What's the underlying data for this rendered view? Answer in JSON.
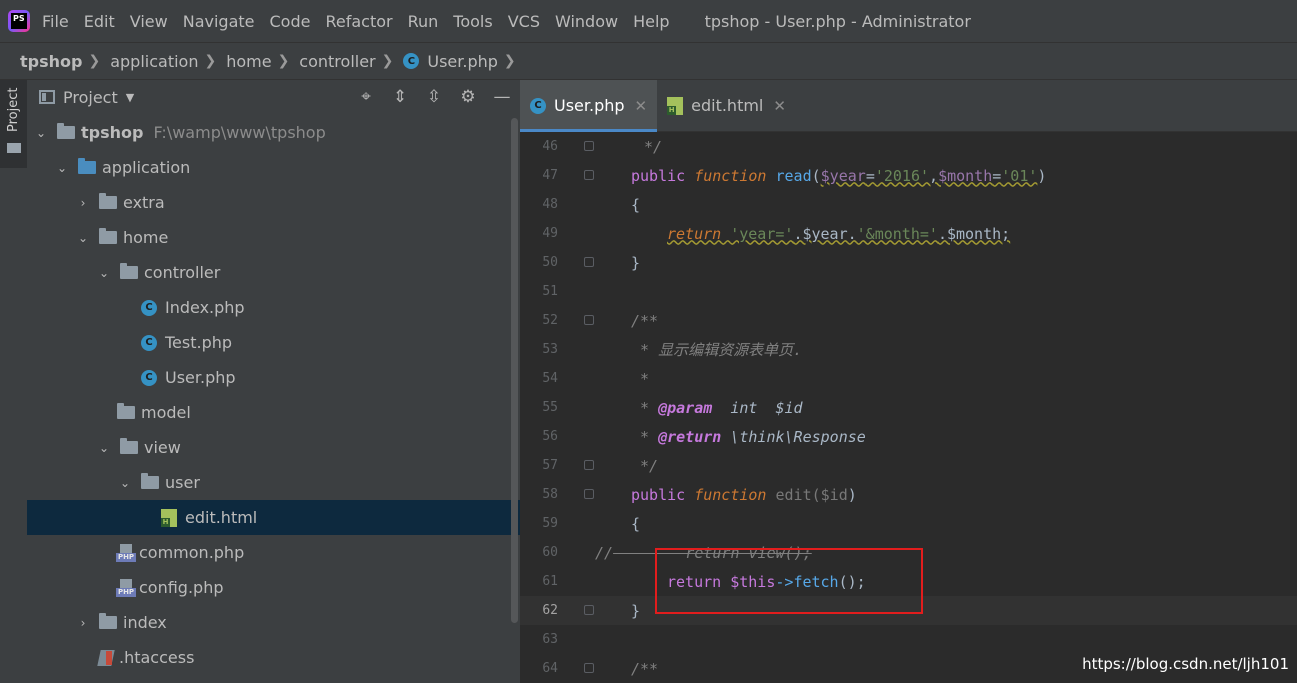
{
  "menubar": {
    "logo_text": "PS",
    "items": [
      "File",
      "Edit",
      "View",
      "Navigate",
      "Code",
      "Refactor",
      "Run",
      "Tools",
      "VCS",
      "Window",
      "Help"
    ],
    "window_title": "tpshop - User.php - Administrator"
  },
  "breadcrumb": {
    "items": [
      "tpshop",
      "application",
      "home",
      "controller",
      "User.php"
    ]
  },
  "left_strip": {
    "label": "Project"
  },
  "project_panel": {
    "title": "Project",
    "tree": [
      {
        "label": "tpshop",
        "path": "F:\\wamp\\www\\tpshop",
        "type": "folder",
        "expanded": true
      },
      {
        "label": "application",
        "type": "folder-blue",
        "expanded": true
      },
      {
        "label": "extra",
        "type": "folder",
        "expanded": false
      },
      {
        "label": "home",
        "type": "folder",
        "expanded": true
      },
      {
        "label": "controller",
        "type": "folder",
        "expanded": true
      },
      {
        "label": "Index.php",
        "type": "class"
      },
      {
        "label": "Test.php",
        "type": "class"
      },
      {
        "label": "User.php",
        "type": "class"
      },
      {
        "label": "model",
        "type": "folder"
      },
      {
        "label": "view",
        "type": "folder",
        "expanded": true
      },
      {
        "label": "user",
        "type": "folder",
        "expanded": true
      },
      {
        "label": "edit.html",
        "type": "html",
        "selected": true
      },
      {
        "label": "common.php",
        "type": "php"
      },
      {
        "label": "config.php",
        "type": "php"
      },
      {
        "label": "index",
        "type": "folder",
        "expanded": false
      },
      {
        "label": ".htaccess",
        "type": "htaccess"
      }
    ]
  },
  "editor": {
    "tabs": [
      {
        "label": "User.php",
        "active": true
      },
      {
        "label": "edit.html",
        "active": false
      }
    ],
    "line_numbers": [
      "46",
      "47",
      "48",
      "49",
      "50",
      "51",
      "52",
      "53",
      "54",
      "55",
      "56",
      "57",
      "58",
      "59",
      "60",
      "61",
      "62",
      "63",
      "64"
    ],
    "current_line": "62",
    "code": {
      "l46": " */",
      "l47_kw": "public",
      "l47_fn": "function",
      "l47_name": "read",
      "l47_p1": "(",
      "l47_var1": "$year",
      "l47_eq1": "=",
      "l47_str1": "'2016'",
      "l47_comma": ",",
      "l47_var2": "$month",
      "l47_eq2": "=",
      "l47_str2": "'01'",
      "l47_p2": ")",
      "l48": "{",
      "l49_kw": "return",
      "l49_str1": "'year='",
      "l49_dot1": ".",
      "l49_var1": "$year",
      "l49_dot2": ".",
      "l49_str2": "'&month='",
      "l49_dot3": ".",
      "l49_var2": "$month",
      "l49_semi": ";",
      "l50": "}",
      "l52": "/**",
      "l53": " * 显示编辑资源表单页.",
      "l54": " *",
      "l55_star": " * ",
      "l55_key": "@param",
      "l55_type": "  int  ",
      "l55_var": "$id",
      "l56_star": " * ",
      "l56_key": "@return",
      "l56_type": " \\think\\Response",
      "l57": " */",
      "l58_kw": "public",
      "l58_fn": "function",
      "l58_name": " edit(",
      "l58_var": "$id",
      "l58_close": ")",
      "l59": "{",
      "l60_slash": "//",
      "l60_text": "        return view();",
      "l61_kw": "return",
      "l61_var": "$this",
      "l61_arrow": "->",
      "l61_fn": "fetch",
      "l61_rest": "();",
      "l62": "}",
      "l64": "/**"
    }
  },
  "watermark": "https://blog.csdn.net/ljh101",
  "colors": {
    "accent": "#4a88c7",
    "highlight_box": "#e21d1d",
    "background": "#2b2b2b",
    "panel": "#3c3f41"
  }
}
